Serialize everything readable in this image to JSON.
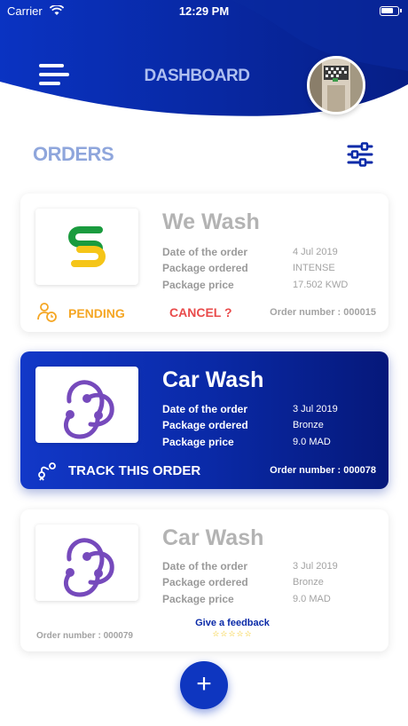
{
  "status_bar": {
    "carrier": "Carrier",
    "time": "12:29 PM"
  },
  "header": {
    "title": "DASHBOARD"
  },
  "section": {
    "title": "ORDERS"
  },
  "colors": {
    "primary": "#0a2aa8",
    "pending": "#f5a623",
    "cancel": "#e94b4b",
    "star": "#f2c200"
  },
  "labels": {
    "date": "Date of the order",
    "package": "Package ordered",
    "price": "Package price",
    "order_number": "Order number :"
  },
  "orders": [
    {
      "name": "We Wash",
      "logo": "subway-s-logo",
      "date": "4 Jul 2019",
      "package": "INTENSE",
      "price": "17.502 KWD",
      "status": "PENDING",
      "cancel_label": "CANCEL ?",
      "order_number": "000015"
    },
    {
      "name": "Car Wash",
      "logo": "redux-logo",
      "date": "3 Jul 2019",
      "package": "Bronze",
      "price": "9.0 MAD",
      "action": "TRACK THIS ORDER",
      "order_number": "000078"
    },
    {
      "name": "Car Wash",
      "logo": "redux-logo",
      "date": "3 Jul 2019",
      "package": "Bronze",
      "price": "9.0 MAD",
      "feedback_label": "Give a feedback",
      "feedback_stars": "☆☆☆☆☆",
      "order_number": "000079"
    }
  ],
  "fab": {
    "label": "+"
  }
}
